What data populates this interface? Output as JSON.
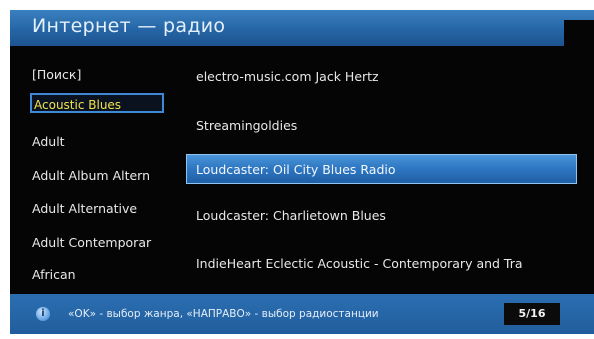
{
  "header": {
    "title": "Интернет — радио"
  },
  "genres": {
    "items": [
      "[Поиск]",
      "Acoustic Blues",
      "Adult",
      "Adult Album Altern",
      "Adult Alternative",
      "Adult Contemporar",
      "African"
    ],
    "selected_index": 1
  },
  "stations": {
    "items": [
      "electro-music.com  Jack Hertz",
      "Streamingoldies",
      "Loudcaster: Oil City Blues Radio",
      "Loudcaster: Charlietown Blues",
      "IndieHeart Eclectic Acoustic - Contemporary and Tra"
    ],
    "selected_index": 2
  },
  "footer": {
    "info_icon": "info-icon",
    "hint": "«OK» - выбор жанра, «НАПРАВО» - выбор радиостанции",
    "pager": "5/16"
  },
  "colors": {
    "accent": "#2f78c3",
    "selected_genre_text": "#f3e34a",
    "background": "#050505"
  }
}
